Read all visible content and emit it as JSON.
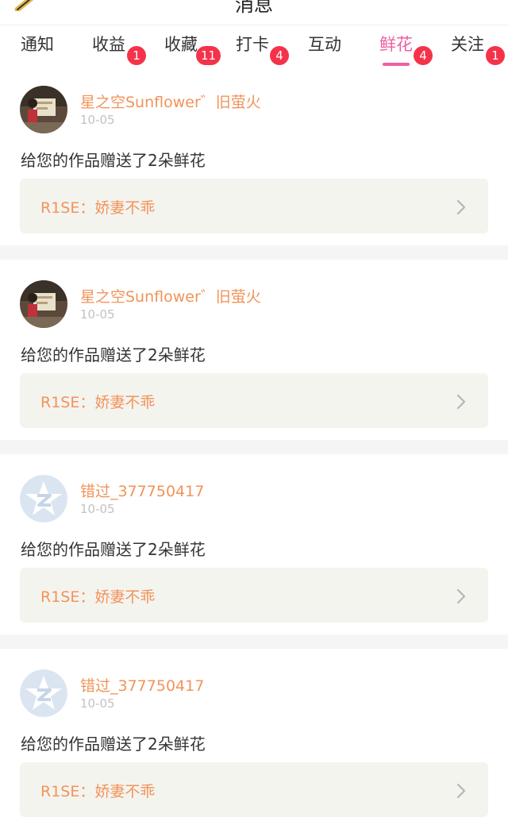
{
  "header": {
    "title": "消息",
    "edit_icon": "pencil-icon"
  },
  "tabs": [
    {
      "label": "通知",
      "badge": ""
    },
    {
      "label": "收益",
      "badge": "1"
    },
    {
      "label": "收藏",
      "badge": "11"
    },
    {
      "label": "打卡",
      "badge": "4"
    },
    {
      "label": "互动",
      "badge": ""
    },
    {
      "label": "鲜花",
      "badge": "4",
      "active": true
    },
    {
      "label": "关注",
      "badge": "1"
    }
  ],
  "colors": {
    "accent": "#ee5fa2",
    "badge": "#f4334a",
    "username": "#f2935a",
    "work_bg": "#f4f4ef"
  },
  "items": [
    {
      "user": "星之空Sunflower゛旧萤火",
      "avatar": "photo-avatar",
      "date": "10-05",
      "message": "给您的作品赠送了2朵鲜花",
      "work": "R1SE：娇妻不乖"
    },
    {
      "user": "星之空Sunflower゛旧萤火",
      "avatar": "photo-avatar",
      "date": "10-05",
      "message": "给您的作品赠送了2朵鲜花",
      "work": "R1SE：娇妻不乖"
    },
    {
      "user": "错过_377750417",
      "avatar": "qq-default-avatar",
      "date": "10-05",
      "message": "给您的作品赠送了2朵鲜花",
      "work": "R1SE：娇妻不乖"
    },
    {
      "user": "错过_377750417",
      "avatar": "qq-default-avatar",
      "date": "10-05",
      "message": "给您的作品赠送了2朵鲜花",
      "work": "R1SE：娇妻不乖"
    }
  ]
}
